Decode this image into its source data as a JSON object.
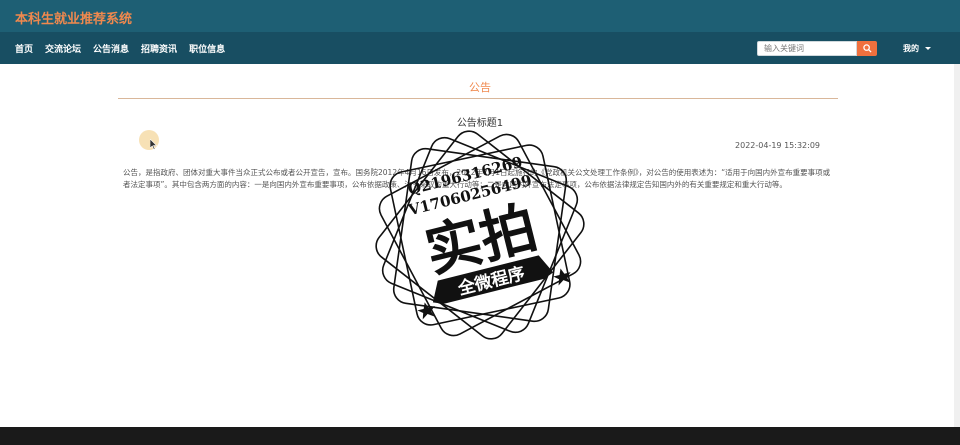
{
  "header": {
    "site_title": "本科生就业推荐系统"
  },
  "nav": {
    "items": [
      {
        "label": "首页"
      },
      {
        "label": "交流论坛"
      },
      {
        "label": "公告消息"
      },
      {
        "label": "招聘资讯"
      },
      {
        "label": "职位信息"
      }
    ],
    "search_placeholder": "输入关键词",
    "search_icon": "search-icon",
    "user_label": "我的"
  },
  "page": {
    "section_title": "公告"
  },
  "article": {
    "title": "公告标题1",
    "date": "2022-04-19 15:32:09",
    "body": "公告，是指政府、团体对重大事件当众正式公布或者公开宣告，宣布。国务院2012年4月16日发布，2012年7月1日起施行的《党政机关公文处理工作条例》，对公告的使用表述为：“适用于向国内外宣布重要事项或者法定事项”。其中包含两方面的内容：一是向国内外宣布重要事项，公布依据政策、法令采取的重大行动等；二是向国内外宣布法定事项，公布依据法律规定告知国内外的有关重要规定和重大行动等。"
  },
  "watermark": {
    "line1": "Q2196316269",
    "line2": "V17060256499",
    "main": "实拍",
    "banner": "全微程序"
  },
  "colors": {
    "topbar": "#1e5f74",
    "navbar": "#184e62",
    "accent": "#f0894e",
    "search_button": "#f0703e"
  }
}
